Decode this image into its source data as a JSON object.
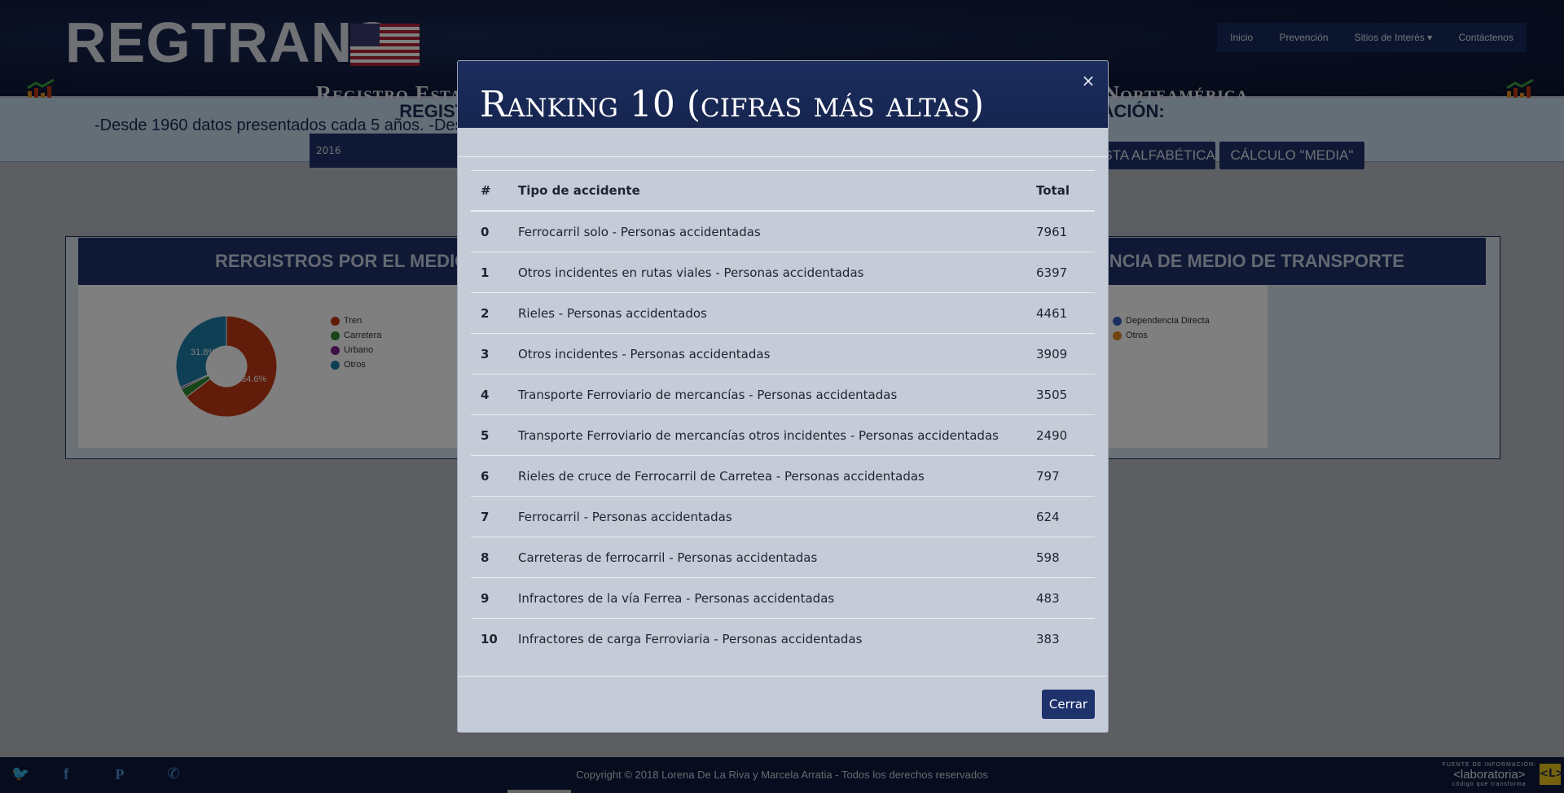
{
  "header": {
    "logo": "REGTRANS",
    "subtitle": "Registro Estadístico de Accidentes de Transporte de los Estados Unidos de Norteamérica",
    "nav": [
      "Inicio",
      "Prevención",
      "Sitios de Interés",
      "Contáctenos"
    ]
  },
  "band": {
    "title": "REGISTROS POR AÑO DE ACCIDENTES CON DIFERENTES FUENTES DE INFORMACIÓN:",
    "line": "-Desde 1960 datos presentados cada 5 años. -Desde 2010 datos presentados anualmente. Seleccione el Reporte requerido",
    "year": "2016",
    "btn_alpha": "LISTA ALFABÉTICA",
    "btn_media": "CÁLCULO \"MEDIA\""
  },
  "panel": {
    "left_title": "RERGISTROS POR EL MEDIO DE TRANSPORTE",
    "right_title": "DEPENDENCIA DE MEDIO DE TRANSPORTE"
  },
  "chart_data": {
    "type": "pie",
    "categories": [
      "Tren",
      "Carretera",
      "Urbano",
      "Otros"
    ],
    "values": [
      64.6,
      3.0,
      0.6,
      31.8
    ],
    "labels_shown": [
      "64.6%",
      "31.8%"
    ],
    "colors": [
      "#c23a12",
      "#2e8b2e",
      "#7b1f8f",
      "#1f7fa8"
    ],
    "donut": true,
    "legend_right": [
      "Dependencia Directa",
      "Otros"
    ],
    "legend_right_colors": [
      "#3b5fc4",
      "#e08a1e"
    ]
  },
  "modal": {
    "title": "Ranking 10 (cifras más altas)",
    "close": "×",
    "headers": [
      "#",
      "Tipo de accidente",
      "Total"
    ],
    "rows": [
      {
        "n": "0",
        "tipo": "Ferrocarril solo - Personas accidentadas",
        "total": "7961"
      },
      {
        "n": "1",
        "tipo": "Otros incidentes en rutas viales - Personas accidentadas",
        "total": "6397"
      },
      {
        "n": "2",
        "tipo": "Rieles - Personas accidentados",
        "total": "4461"
      },
      {
        "n": "3",
        "tipo": "Otros incidentes - Personas accidentadas",
        "total": "3909"
      },
      {
        "n": "4",
        "tipo": "Transporte Ferroviario de mercancías - Personas accidentadas",
        "total": "3505"
      },
      {
        "n": "5",
        "tipo": "Transporte Ferroviario de mercancías otros incidentes - Personas accidentadas",
        "total": "2490"
      },
      {
        "n": "6",
        "tipo": "Rieles de cruce de Ferrocarril de Carretea - Personas accidentadas",
        "total": "797"
      },
      {
        "n": "7",
        "tipo": "Ferrocarril - Personas accidentadas",
        "total": "624"
      },
      {
        "n": "8",
        "tipo": "Carreteras de ferrocarril - Personas accidentadas",
        "total": "598"
      },
      {
        "n": "9",
        "tipo": "Infractores de la vía Ferrea - Personas accidentadas",
        "total": "483"
      },
      {
        "n": "10",
        "tipo": "Infractores de carga Ferroviaria - Personas accidentadas",
        "total": "383"
      }
    ],
    "close_button": "Cerrar"
  },
  "footer": {
    "copyright": "Copyright © 2018 Lorena De La Riva y Marcela Arratia - Todos los derechos reservados",
    "source_label": "FUENTE DE INFORMACIÓN:",
    "source_name": "<laboratoria>",
    "source_tag": "código que transforma",
    "badge": "<L>"
  }
}
